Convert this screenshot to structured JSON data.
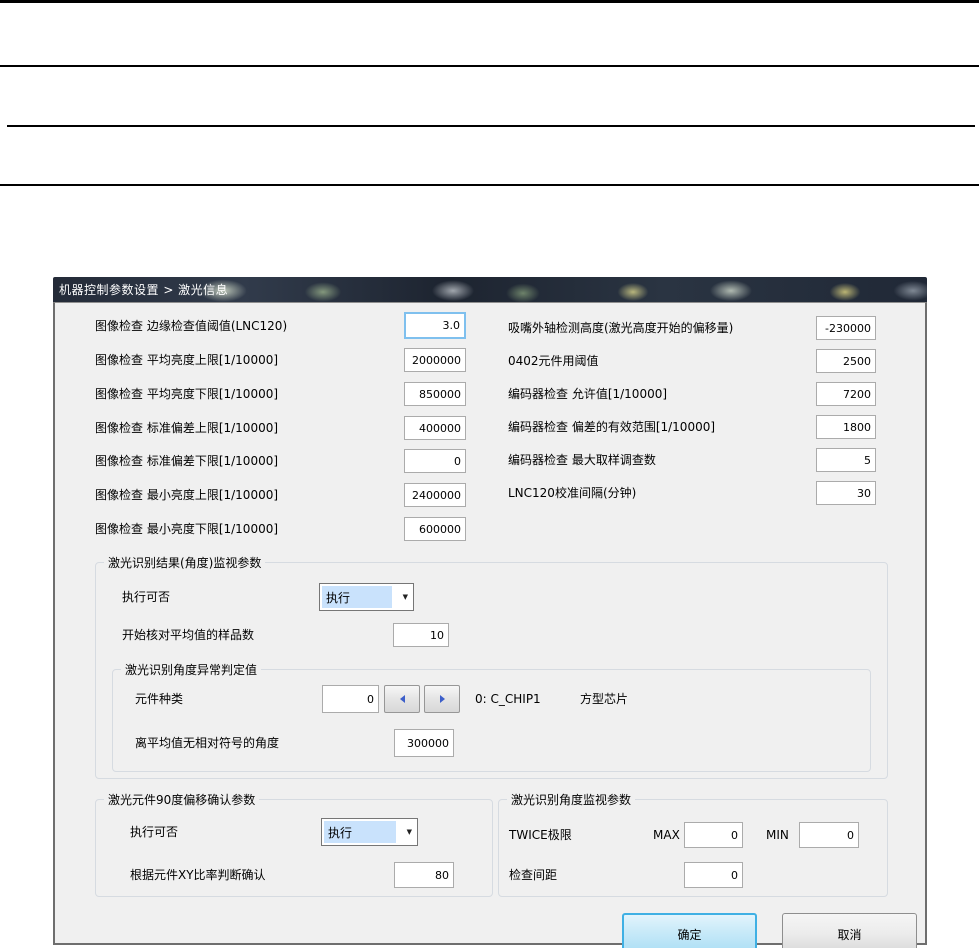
{
  "window": {
    "title": "机器控制参数设置 > 激光信息"
  },
  "fields_left": [
    {
      "label": "图像检查 边缘检查值阈值(LNC120)",
      "value": "3.0"
    },
    {
      "label": "图像检查 平均亮度上限[1/10000]",
      "value": "2000000"
    },
    {
      "label": "图像检查 平均亮度下限[1/10000]",
      "value": "850000"
    },
    {
      "label": "图像检查 标准偏差上限[1/10000]",
      "value": "400000"
    },
    {
      "label": "图像检查 标准偏差下限[1/10000]",
      "value": "0"
    },
    {
      "label": "图像检查 最小亮度上限[1/10000]",
      "value": "2400000"
    },
    {
      "label": "图像检查 最小亮度下限[1/10000]",
      "value": "600000"
    }
  ],
  "fields_right": [
    {
      "label": "吸嘴外轴检测高度(激光高度开始的偏移量)",
      "value": "-230000"
    },
    {
      "label": "0402元件用阈值",
      "value": "2500"
    },
    {
      "label": "编码器检查 允许值[1/10000]",
      "value": "7200"
    },
    {
      "label": "编码器检查 偏差的有效范围[1/10000]",
      "value": "1800"
    },
    {
      "label": "编码器检查 最大取样调查数",
      "value": "5"
    },
    {
      "label": "LNC120校准间隔(分钟)",
      "value": "30"
    }
  ],
  "group_laser_result": {
    "title": "激光识别结果(角度)监视参数",
    "exec_label": "执行可否",
    "exec_value": "执行",
    "sample_label": "开始核对平均值的样品数",
    "sample_value": "10",
    "judge_group": {
      "title": "激光识别角度异常判定值",
      "part_type_label": "元件种类",
      "part_type_value": "0",
      "part_type_desc": "0: C_CHIP1",
      "part_type_desc2": "方型芯片",
      "angle_label": "离平均值无相对符号的角度",
      "angle_value": "300000"
    }
  },
  "group_offset90": {
    "title": "激光元件90度偏移确认参数",
    "exec_label": "执行可否",
    "exec_value": "执行",
    "ratio_label": "根据元件XY比率判断确认",
    "ratio_value": "80"
  },
  "group_angle_monitor": {
    "title": "激光识别角度监视参数",
    "twice_label": "TWICE极限",
    "max_label": "MAX",
    "max_value": "0",
    "min_label": "MIN",
    "min_value": "0",
    "pitch_label": "检查间距",
    "pitch_value": "0"
  },
  "buttons": {
    "ok": "确定",
    "cancel": "取消"
  },
  "colors": {
    "selection_blue": "#c9e2fc",
    "focus_border_blue": "#7fc0ee",
    "ok_button_border": "#3fb0e4",
    "client_background": "#f0f0f0",
    "titlebar_text": "#ffffff"
  }
}
